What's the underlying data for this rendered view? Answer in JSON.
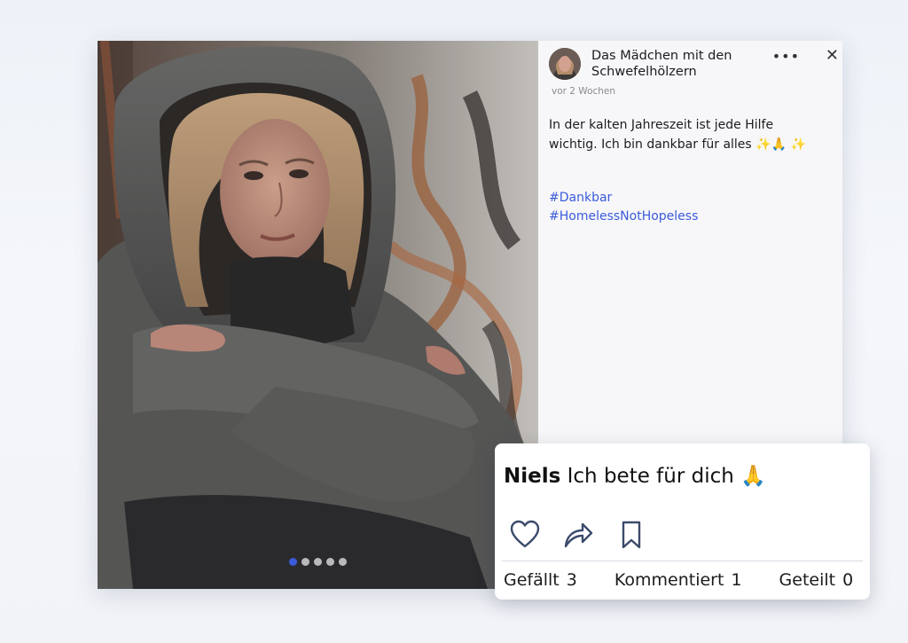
{
  "post": {
    "author_name": "Das Mädchen mit den Schwefelhölzern",
    "timestamp": "vor 2 Wochen",
    "caption": "In der kalten Jahreszeit ist jede Hilfe wichtig. Ich bin dankbar für alles ✨🙏 ✨",
    "hashtags": [
      "#Dankbar",
      "#HomelessNotHopeless"
    ],
    "more_icon": "more-horizontal-icon",
    "close_icon": "close-icon",
    "hashtag_color": "#3b5bdb",
    "image_description_icon": "photo",
    "carousel": {
      "total": 5,
      "active_index": 0,
      "active_color": "#3b5bdb"
    }
  },
  "comment": {
    "author": "Niels",
    "text": "Ich bete für dich 🙏",
    "actions": [
      {
        "icon": "heart-icon"
      },
      {
        "icon": "share-arrow-icon"
      },
      {
        "icon": "bookmark-icon"
      }
    ],
    "stats": {
      "likes_label": "Gefällt",
      "likes_count": "3",
      "comments_label": "Kommentiert",
      "comments_count": "1",
      "shares_label": "Geteilt",
      "shares_count": "0"
    }
  }
}
